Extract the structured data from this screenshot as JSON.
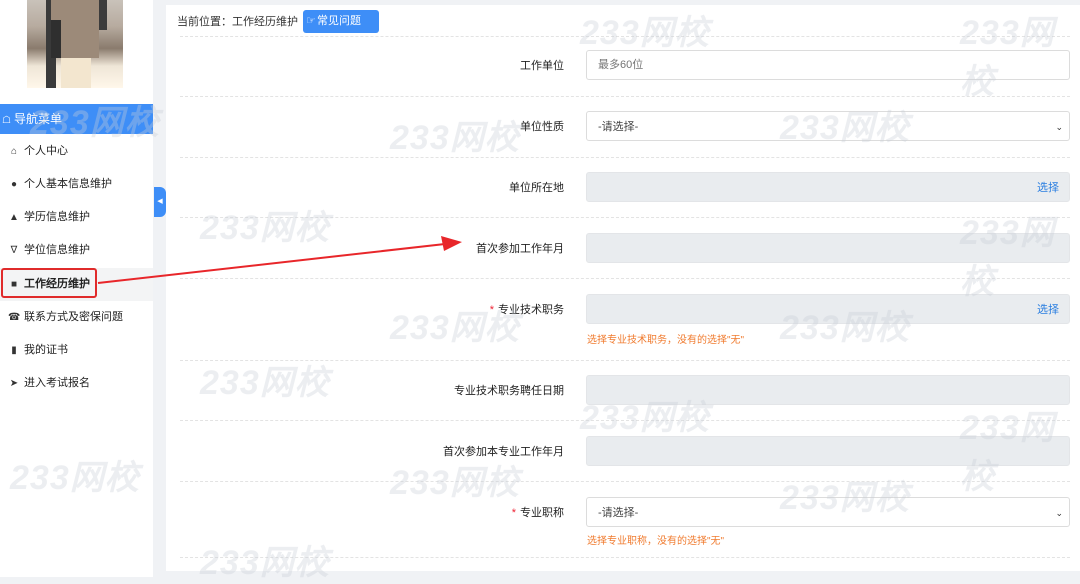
{
  "sidebar": {
    "nav_header": "导航菜单",
    "items": [
      {
        "label": "个人中心",
        "icon": "home-icon"
      },
      {
        "label": "个人基本信息维护",
        "icon": "user-icon"
      },
      {
        "label": "学历信息维护",
        "icon": "graduation-cap-icon"
      },
      {
        "label": "学位信息维护",
        "icon": "degree-icon"
      },
      {
        "label": "工作经历维护",
        "icon": "briefcase-icon",
        "active": true
      },
      {
        "label": "联系方式及密保问题",
        "icon": "phone-icon"
      },
      {
        "label": "我的证书",
        "icon": "book-icon"
      },
      {
        "label": "进入考试报名",
        "icon": "circle-arrow-icon"
      }
    ]
  },
  "breadcrumb": "当前位置：工作经历维护",
  "faq_button": "常见问题",
  "form": {
    "work_unit": {
      "label": "工作单位",
      "placeholder": "最多60位"
    },
    "unit_nature": {
      "label": "单位性质",
      "value": "-请选择-"
    },
    "unit_location": {
      "label": "单位所在地",
      "action": "选择"
    },
    "first_work_date": {
      "label": "首次参加工作年月"
    },
    "tech_position": {
      "label": "专业技术职务",
      "action": "选择",
      "hint": "选择专业技术职务，没有的选择\"无\"",
      "required_mark": "*"
    },
    "tech_position_date": {
      "label": "专业技术职务聘任日期"
    },
    "first_major_work_date": {
      "label": "首次参加本专业工作年月"
    },
    "professional_title": {
      "label": "专业职称",
      "value": "-请选择-",
      "hint": "选择专业职称，没有的选择\"无\"",
      "required_mark": "*"
    }
  },
  "watermark": "233网校",
  "colors": {
    "accent": "#3e8ef7",
    "highlight": "#e02b2b",
    "hint": "#f07b2f",
    "link": "#2a7ee0"
  }
}
